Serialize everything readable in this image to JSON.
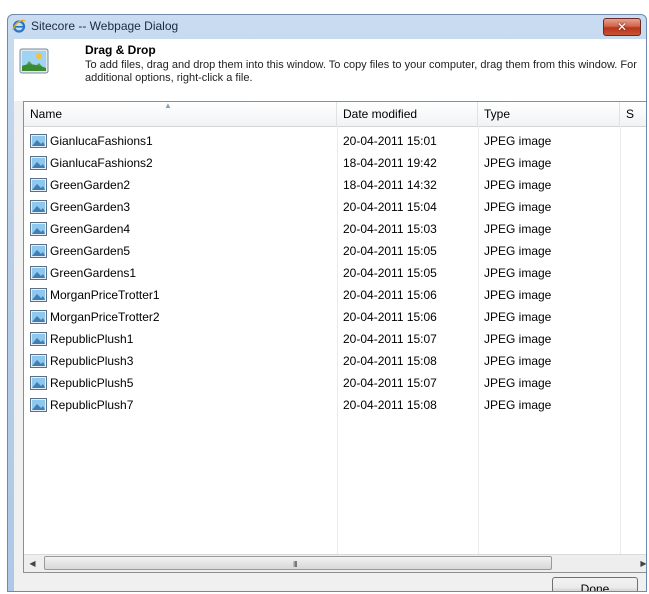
{
  "window": {
    "title": "Sitecore -- Webpage Dialog",
    "close_label": "✕"
  },
  "header": {
    "title": "Drag & Drop",
    "description": "To add files, drag and drop them into this window. To copy files to your computer, drag them from this window. For additional options, right-click a file."
  },
  "columns": {
    "name": "Name",
    "date": "Date modified",
    "type": "Type",
    "size": "S"
  },
  "files": [
    {
      "name": "GianlucaFashions1",
      "date": "20-04-2011 15:01",
      "type": "JPEG image"
    },
    {
      "name": "GianlucaFashions2",
      "date": "18-04-2011 19:42",
      "type": "JPEG image"
    },
    {
      "name": "GreenGarden2",
      "date": "18-04-2011 14:32",
      "type": "JPEG image"
    },
    {
      "name": "GreenGarden3",
      "date": "20-04-2011 15:04",
      "type": "JPEG image"
    },
    {
      "name": "GreenGarden4",
      "date": "20-04-2011 15:03",
      "type": "JPEG image"
    },
    {
      "name": "GreenGarden5",
      "date": "20-04-2011 15:05",
      "type": "JPEG image"
    },
    {
      "name": "GreenGardens1",
      "date": "20-04-2011 15:05",
      "type": "JPEG image"
    },
    {
      "name": "MorganPriceTrotter1",
      "date": "20-04-2011 15:06",
      "type": "JPEG image"
    },
    {
      "name": "MorganPriceTrotter2",
      "date": "20-04-2011 15:06",
      "type": "JPEG image"
    },
    {
      "name": "RepublicPlush1",
      "date": "20-04-2011 15:07",
      "type": "JPEG image"
    },
    {
      "name": "RepublicPlush3",
      "date": "20-04-2011 15:08",
      "type": "JPEG image"
    },
    {
      "name": "RepublicPlush5",
      "date": "20-04-2011 15:07",
      "type": "JPEG image"
    },
    {
      "name": "RepublicPlush7",
      "date": "20-04-2011 15:08",
      "type": "JPEG image"
    }
  ],
  "scrollbar": {
    "left_arrow": "◀",
    "right_arrow": "▶",
    "grip": "III"
  },
  "buttons": {
    "done": "Done"
  },
  "icons": {
    "title": "ie-icon",
    "header": "image-folder-icon",
    "file": "jpeg-file-icon"
  },
  "colors": {
    "title_bar": "#b7cfe9",
    "close_button": "#c95134",
    "dialog_background": "#f0f0f0"
  }
}
